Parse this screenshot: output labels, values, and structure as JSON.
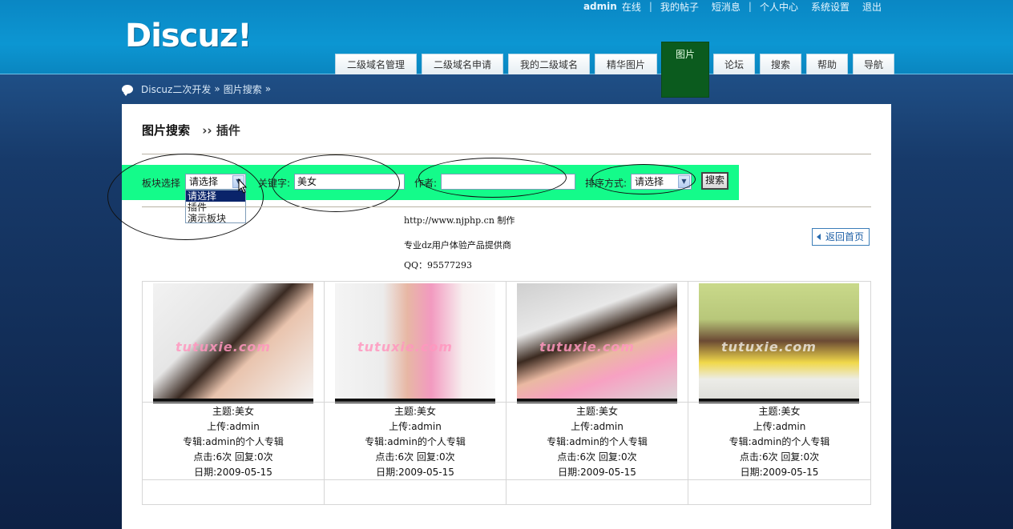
{
  "header": {
    "logo": "Discuz!",
    "user": "admin",
    "online": "在线",
    "links": [
      "我的帖子",
      "短消息",
      "个人中心",
      "系统设置",
      "退出"
    ],
    "nav": [
      "二级域名管理",
      "二级域名申请",
      "我的二级域名",
      "精华图片",
      "图片",
      "论坛",
      "搜索",
      "帮助",
      "导航"
    ],
    "active_nav": "图片"
  },
  "breadcrumb": {
    "items": [
      "Discuz二次开发",
      "图片搜索"
    ],
    "separator": "»"
  },
  "page": {
    "title": "图片搜索",
    "subtitle": "›› 插件"
  },
  "filter": {
    "block_label": "板块选择",
    "block_value": "请选择",
    "block_options": [
      "请选择",
      "插件",
      "演示板块"
    ],
    "keyword_label": "关键字:",
    "keyword_value": "美女",
    "author_label": "作者:",
    "author_value": "",
    "sort_label": "排序方式:",
    "sort_value": "请选择",
    "search_button": "搜索",
    "highlight_color": "#14fb8a"
  },
  "info": {
    "line1": "http://www.njphp.cn 制作",
    "line2": "专业dz用户体验产品提供商",
    "line3": "QQ：95577293"
  },
  "back_button": "返回首页",
  "gallery": [
    {
      "subject": "主题:美女",
      "uploader": "上传:admin",
      "album": "专辑:admin的个人专辑",
      "stats": "点击:6次 回复:0次",
      "date": "日期:2009-05-15",
      "watermark": "tutuxie.com"
    },
    {
      "subject": "主题:美女",
      "uploader": "上传:admin",
      "album": "专辑:admin的个人专辑",
      "stats": "点击:6次 回复:0次",
      "date": "日期:2009-05-15",
      "watermark": "tutuxie.com"
    },
    {
      "subject": "主题:美女",
      "uploader": "上传:admin",
      "album": "专辑:admin的个人专辑",
      "stats": "点击:6次 回复:0次",
      "date": "日期:2009-05-15",
      "watermark": "tutuxie.com"
    },
    {
      "subject": "主题:美女",
      "uploader": "上传:admin",
      "album": "专辑:admin的个人专辑",
      "stats": "点击:6次 回复:0次",
      "date": "日期:2009-05-15",
      "watermark": "tutuxie.com"
    }
  ]
}
